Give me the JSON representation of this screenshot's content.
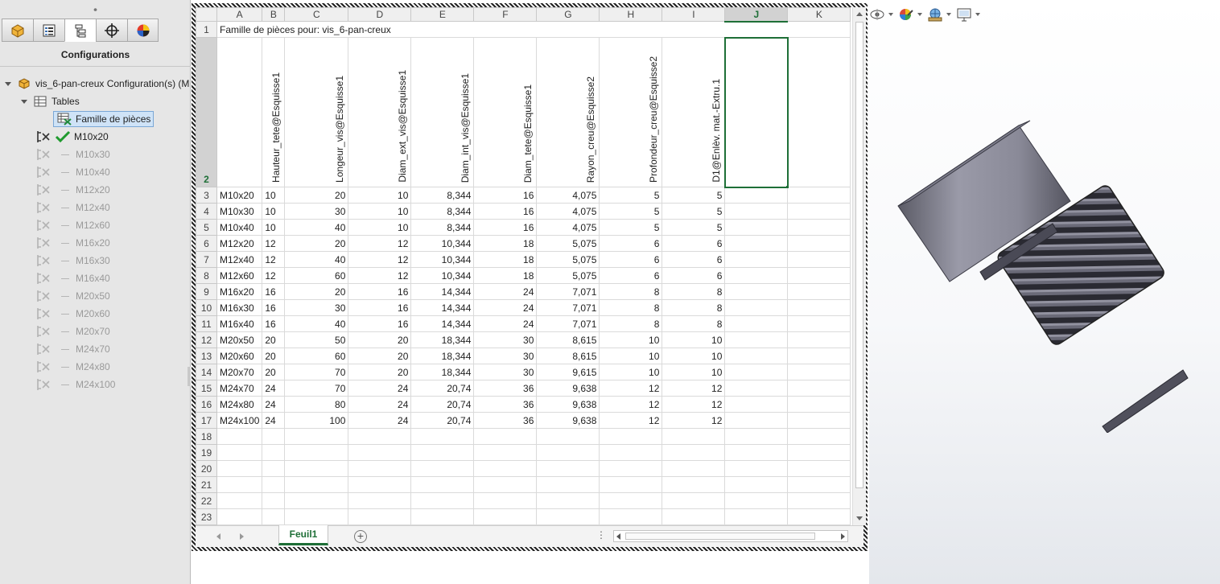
{
  "panel": {
    "grip": "⦁",
    "tabs": [
      {
        "icon": "part-icon"
      },
      {
        "icon": "property-manager-icon"
      },
      {
        "icon": "configuration-manager-icon",
        "active": true
      },
      {
        "icon": "dimxpert-icon"
      },
      {
        "icon": "display-manager-icon"
      }
    ],
    "title": "Configurations"
  },
  "tree": {
    "root_label": "vis_6-pan-creux Configuration(s)  (M",
    "tables_label": "Tables",
    "family_label": "Famille de pièces",
    "active_config": "M10x20",
    "configs": [
      "M10x30",
      "M10x40",
      "M12x20",
      "M12x40",
      "M12x60",
      "M16x20",
      "M16x30",
      "M16x40",
      "M20x50",
      "M20x60",
      "M20x70",
      "M24x70",
      "M24x80",
      "M24x100"
    ]
  },
  "sheet": {
    "columns": [
      "A",
      "B",
      "C",
      "D",
      "E",
      "F",
      "G",
      "H",
      "I",
      "J",
      "K"
    ],
    "selected_column": "J",
    "title_cell": "Famille de pièces pour: vis_6-pan-creux",
    "param_headers": [
      "Hauteur_tete@Esquisse1",
      "Longeur_vis@Esquisse1",
      "Diam_ext_vis@Esquisse1",
      "Diam_int_vis@Esquisse1",
      "Diam_tete@Esquisse1",
      "Rayon_creu@Esquisse2",
      "Profondeur_creu@Esquisse2",
      "D1@Enlèv. mat.-Extru.1"
    ],
    "rows": [
      [
        "M10x20",
        "10",
        "20",
        "10",
        "8,344",
        "16",
        "4,075",
        "5",
        "5"
      ],
      [
        "M10x30",
        "10",
        "30",
        "10",
        "8,344",
        "16",
        "4,075",
        "5",
        "5"
      ],
      [
        "M10x40",
        "10",
        "40",
        "10",
        "8,344",
        "16",
        "4,075",
        "5",
        "5"
      ],
      [
        "M12x20",
        "12",
        "20",
        "12",
        "10,344",
        "18",
        "5,075",
        "6",
        "6"
      ],
      [
        "M12x40",
        "12",
        "40",
        "12",
        "10,344",
        "18",
        "5,075",
        "6",
        "6"
      ],
      [
        "M12x60",
        "12",
        "60",
        "12",
        "10,344",
        "18",
        "5,075",
        "6",
        "6"
      ],
      [
        "M16x20",
        "16",
        "20",
        "16",
        "14,344",
        "24",
        "7,071",
        "8",
        "8"
      ],
      [
        "M16x30",
        "16",
        "30",
        "16",
        "14,344",
        "24",
        "7,071",
        "8",
        "8"
      ],
      [
        "M16x40",
        "16",
        "40",
        "16",
        "14,344",
        "24",
        "7,071",
        "8",
        "8"
      ],
      [
        "M20x50",
        "20",
        "50",
        "20",
        "18,344",
        "30",
        "8,615",
        "10",
        "10"
      ],
      [
        "M20x60",
        "20",
        "60",
        "20",
        "18,344",
        "30",
        "8,615",
        "10",
        "10"
      ],
      [
        "M20x70",
        "20",
        "70",
        "20",
        "18,344",
        "30",
        "9,615",
        "10",
        "10"
      ],
      [
        "M24x70",
        "24",
        "70",
        "24",
        "20,74",
        "36",
        "9,638",
        "12",
        "12"
      ],
      [
        "M24x80",
        "24",
        "80",
        "24",
        "20,74",
        "36",
        "9,638",
        "12",
        "12"
      ],
      [
        "M24x100",
        "24",
        "100",
        "24",
        "20,74",
        "36",
        "9,638",
        "12",
        "12"
      ]
    ],
    "empty_rows": [
      "18",
      "19",
      "20",
      "21",
      "22",
      "23"
    ],
    "sheet_tab": "Feuil1",
    "add_sheet": "+",
    "tab_dots": "⋮"
  },
  "colors": {
    "excel_green": "#1e6f37",
    "selection_blue": "#cfe3f7",
    "panel_bg": "#e6e6e6"
  },
  "viewport": {
    "toolbar": [
      {
        "icon": "hide-show-items-icon"
      },
      {
        "icon": "edit-appearance-icon"
      },
      {
        "icon": "apply-scene-icon"
      },
      {
        "icon": "view-settings-icon"
      }
    ],
    "model": "socket-head-cap-screw-model"
  }
}
